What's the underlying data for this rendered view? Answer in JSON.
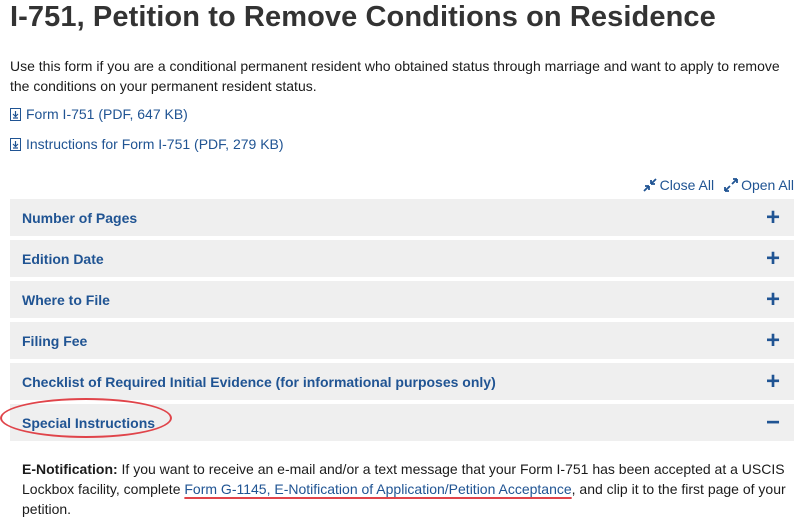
{
  "page": {
    "title": "I-751, Petition to Remove Conditions on Residence",
    "intro": "Use this form if you are a conditional permanent resident who obtained status through marriage and want to apply to remove the conditions on your permanent resident status."
  },
  "downloads": [
    {
      "label": "Form I-751 (PDF, 647 KB)",
      "icon": "download-icon"
    },
    {
      "label": "Instructions for Form I-751 (PDF, 279 KB)",
      "icon": "download-icon"
    }
  ],
  "controls": {
    "close_all": "Close All",
    "open_all": "Open All"
  },
  "accordion": [
    {
      "label": "Number of Pages",
      "toggle": "+"
    },
    {
      "label": "Edition Date",
      "toggle": "+"
    },
    {
      "label": "Where to File",
      "toggle": "+"
    },
    {
      "label": "Filing Fee",
      "toggle": "+"
    },
    {
      "label": "Checklist of Required Initial Evidence (for informational purposes only)",
      "toggle": "+"
    },
    {
      "label": "Special Instructions",
      "toggle": "−"
    }
  ],
  "special_instructions": {
    "heading": "E-Notification:",
    "text_before": " If you want to receive an e-mail and/or a text message that your Form I-751 has been accepted at a USCIS Lockbox facility, complete ",
    "link": "Form G-1145, E-Notification of Application/Petition Acceptance",
    "text_after": ", and clip it to the first page of your petition."
  },
  "colors": {
    "link": "#205493",
    "accordion_bg": "#efefef",
    "annotation": "#e0444a"
  }
}
